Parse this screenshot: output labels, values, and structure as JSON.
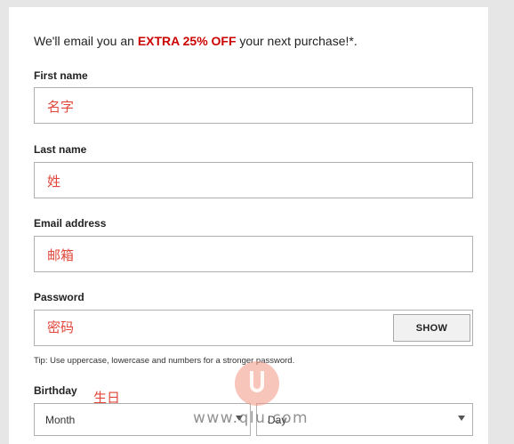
{
  "promo": {
    "prefix": "We'll email you an ",
    "highlight": "EXTRA 25% OFF",
    "suffix": " your next purchase!*."
  },
  "fields": {
    "first_name": {
      "label": "First name",
      "annotation": "名字"
    },
    "last_name": {
      "label": "Last name",
      "annotation": "姓"
    },
    "email": {
      "label": "Email address",
      "annotation": "邮箱"
    },
    "password": {
      "label": "Password",
      "annotation": "密码",
      "show_label": "SHOW"
    }
  },
  "tip": "Tip: Use uppercase, lowercase and numbers for a stronger password.",
  "birthday": {
    "label": "Birthday",
    "annotation": "生日",
    "month_value": "Month",
    "day_value": "Day"
  },
  "watermark": {
    "text": "www.qlu.com"
  },
  "colors": {
    "highlight": "#cc0000",
    "annotation": "#e0463a"
  }
}
